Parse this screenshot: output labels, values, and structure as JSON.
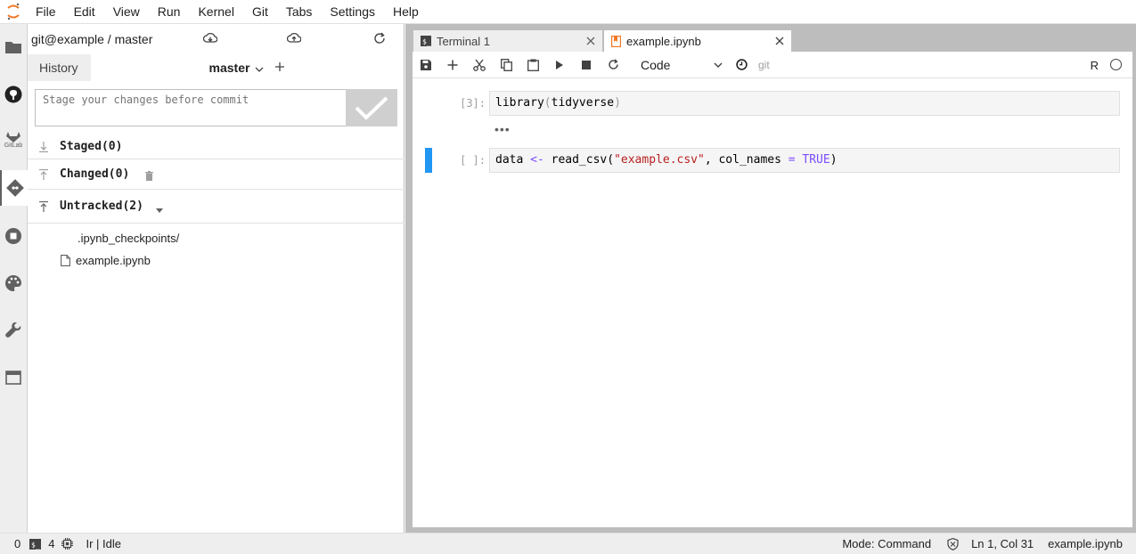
{
  "menubar": {
    "items": [
      "File",
      "Edit",
      "View",
      "Run",
      "Kernel",
      "Git",
      "Tabs",
      "Settings",
      "Help"
    ]
  },
  "activity_bar": {
    "icons": [
      "folder-icon",
      "github-icon",
      "gitlab-icon",
      "git-icon",
      "stop-circle-icon",
      "palette-icon",
      "wrench-icon",
      "tab-icon"
    ],
    "gitlab_label": "GitLab"
  },
  "git_panel": {
    "repo_label": "git@example / master",
    "tabs": {
      "history": "History",
      "branch": "master"
    },
    "commit_placeholder": "Stage your changes before commit",
    "sections": {
      "staged": "Staged(0)",
      "changed": "Changed(0)",
      "untracked": "Untracked(2)"
    },
    "untracked_files": [
      ".ipynb_checkpoints/",
      "example.ipynb"
    ]
  },
  "tabs": [
    {
      "label": "Terminal 1"
    },
    {
      "label": "example.ipynb"
    }
  ],
  "notebook": {
    "cell_type": "Code",
    "git_label": "git",
    "kernel_name": "R",
    "cells": [
      {
        "prompt": "[3]:",
        "code_parts": [
          "library",
          "(",
          "tidyverse",
          ")"
        ],
        "output": "•••"
      },
      {
        "prompt": "[ ]:",
        "code_parts": [
          "data ",
          "<-",
          " read_csv(",
          "\"example.csv\"",
          ", col_names ",
          "=",
          " ",
          "TRUE",
          ")"
        ]
      }
    ]
  },
  "statusbar": {
    "count_a": "0",
    "count_b": "4",
    "kernel_status": "Ir | Idle",
    "mode": "Mode: Command",
    "position": "Ln 1, Col 31",
    "filename": "example.ipynb"
  },
  "colors": {
    "accent_blue": "#2196f3",
    "jupyter_orange": "#f37726",
    "string_red": "#ba2121",
    "operator_purple": "#7c4dff"
  }
}
